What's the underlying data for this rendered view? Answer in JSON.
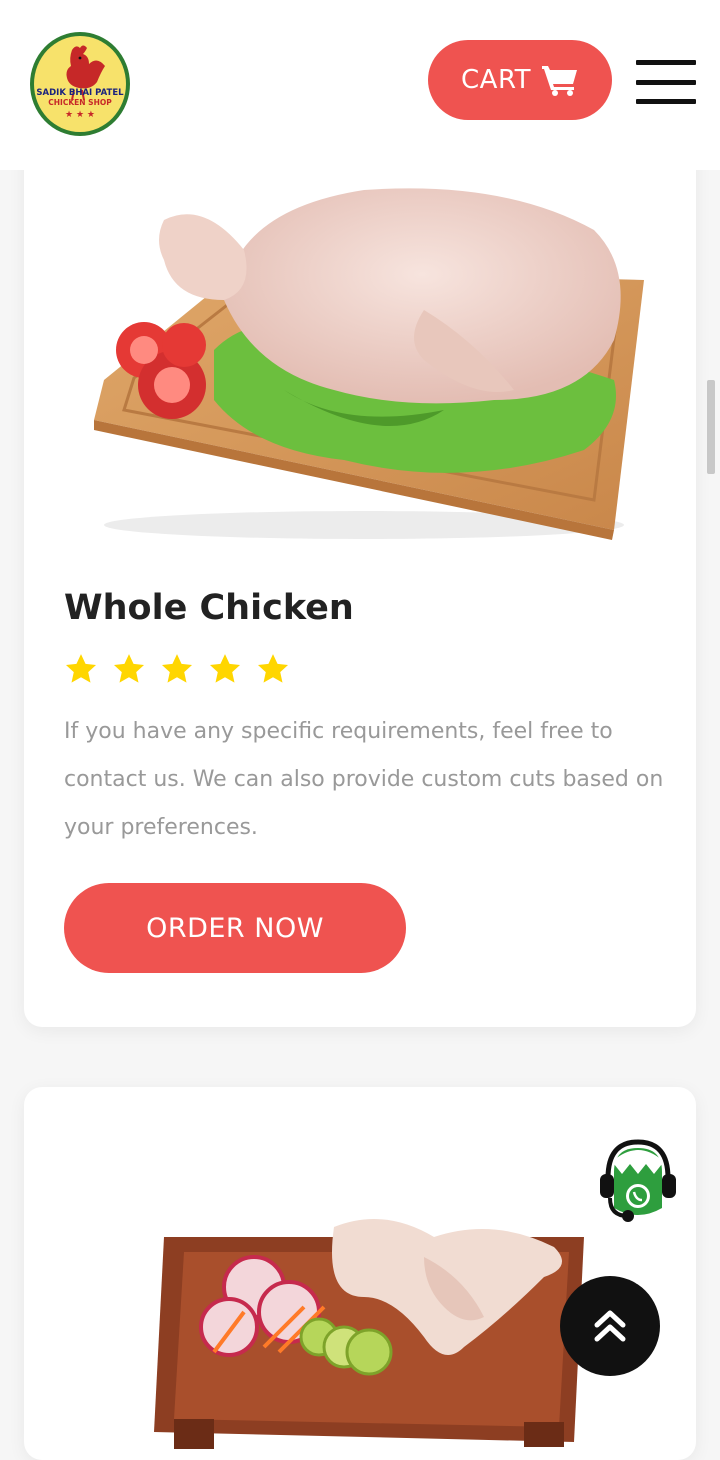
{
  "header": {
    "logo": {
      "line1": "SADIK BHAI PATEL",
      "line2": "CHICKEN SHOP"
    },
    "cart_label": "CART",
    "cart_icon": "shopping-cart-icon",
    "menu_icon": "hamburger-menu-icon"
  },
  "products": [
    {
      "title": "Whole Chicken",
      "rating": 5,
      "rating_max": 5,
      "description": "If you have any specific requirements, feel free to contact us. We can also provide custom cuts based on your preferences.",
      "order_label": "ORDER NOW"
    }
  ],
  "floating": {
    "whatsapp_icon": "whatsapp-support-icon",
    "scroll_top_icon": "double-chevron-up-icon"
  },
  "colors": {
    "accent": "#ef5350",
    "star": "#ffd600",
    "text_dark": "#222222",
    "text_muted": "#999999"
  }
}
